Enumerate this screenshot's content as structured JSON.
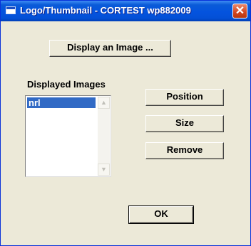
{
  "window": {
    "title": "Logo/Thumbnail - CORTEST wp882009",
    "close_glyph": "✕"
  },
  "buttons": {
    "display_image": "Display an Image ...",
    "position": "Position",
    "size": "Size",
    "remove": "Remove",
    "ok": "OK"
  },
  "displayed_images": {
    "label": "Displayed Images",
    "items": [
      "nrl"
    ],
    "selected": "nrl"
  },
  "scroll": {
    "up_glyph": "▲",
    "down_glyph": "▼"
  },
  "colors": {
    "title_bar": "#0453de",
    "selection": "#316ac5",
    "dialog_bg": "#ece9d8"
  }
}
